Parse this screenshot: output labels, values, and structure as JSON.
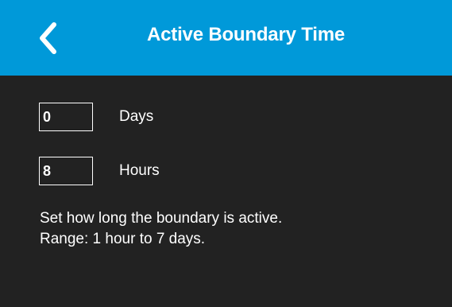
{
  "header": {
    "title": "Active Boundary Time",
    "back_icon": "chevron-left-icon",
    "background_color": "#0099d9"
  },
  "fields": {
    "days": {
      "value": "0",
      "label": "Days"
    },
    "hours": {
      "value": "8",
      "label": "Hours"
    }
  },
  "help": {
    "line1": "Set how long the boundary is active.",
    "line2": "Range: 1 hour to 7 days."
  },
  "colors": {
    "background": "#222222",
    "text": "#ffffff"
  }
}
